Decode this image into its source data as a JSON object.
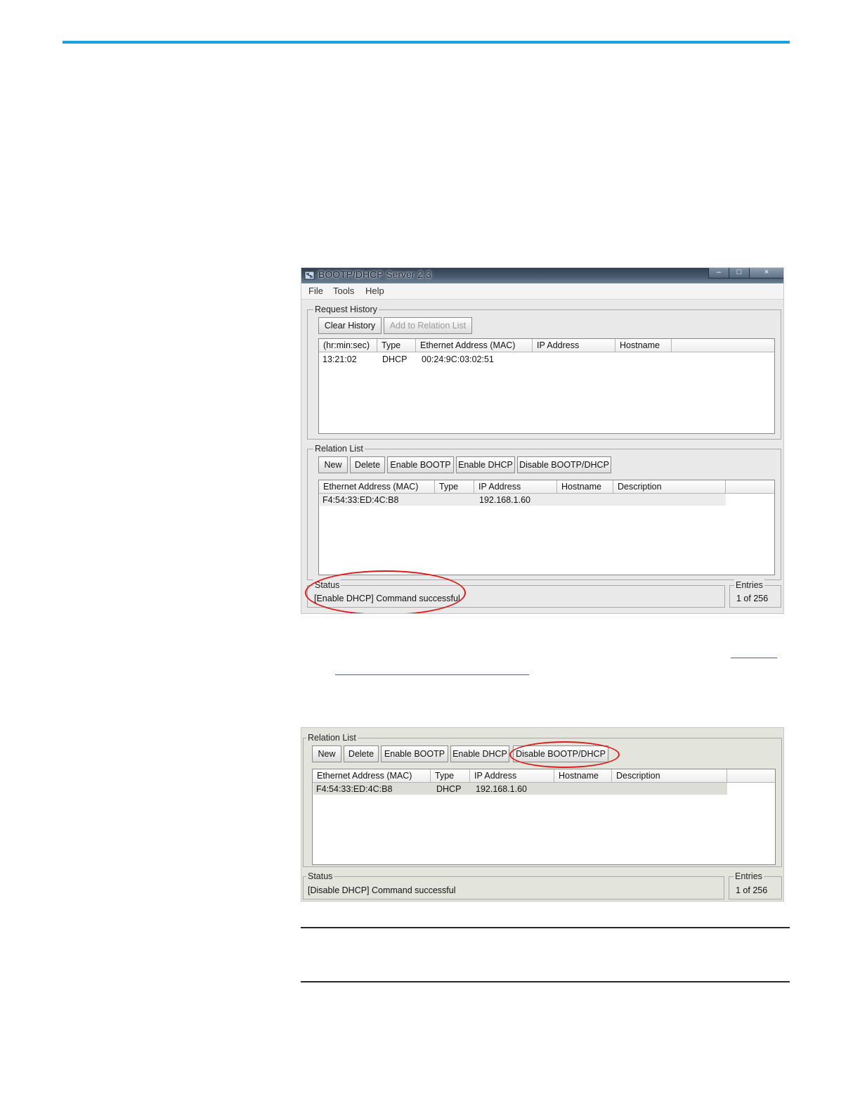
{
  "window1": {
    "title": "BOOTP/DHCP Server 2.3",
    "caption_buttons": [
      "–",
      "□",
      "×"
    ],
    "menu": [
      "File",
      "Tools",
      "Help"
    ],
    "request_history": {
      "label": "Request History",
      "buttons": [
        "Clear History",
        "Add to Relation List"
      ],
      "columns": [
        "(hr:min:sec)",
        "Type",
        "Ethernet Address (MAC)",
        "IP Address",
        "Hostname"
      ],
      "rows": [
        {
          "time": "13:21:02",
          "type": "DHCP",
          "mac": "00:24:9C:03:02:51",
          "ip": "",
          "hostname": ""
        }
      ]
    },
    "relation_list": {
      "label": "Relation List",
      "buttons": [
        "New",
        "Delete",
        "Enable BOOTP",
        "Enable DHCP",
        "Disable BOOTP/DHCP"
      ],
      "columns": [
        "Ethernet Address (MAC)",
        "Type",
        "IP Address",
        "Hostname",
        "Description"
      ],
      "rows": [
        {
          "mac": "F4:54:33:ED:4C:B8",
          "type": "",
          "ip": "192.168.1.60",
          "hostname": "",
          "description": ""
        }
      ]
    },
    "status": {
      "label": "Status",
      "text": "[Enable DHCP] Command successful"
    },
    "entries": {
      "label": "Entries",
      "text": "1 of 256"
    }
  },
  "window2": {
    "relation_list": {
      "label": "Relation List",
      "buttons": [
        "New",
        "Delete",
        "Enable BOOTP",
        "Enable DHCP",
        "Disable BOOTP/DHCP"
      ],
      "columns": [
        "Ethernet Address (MAC)",
        "Type",
        "IP Address",
        "Hostname",
        "Description"
      ],
      "rows": [
        {
          "mac": "F4:54:33:ED:4C:B8",
          "type": "DHCP",
          "ip": "192.168.1.60",
          "hostname": "",
          "description": ""
        }
      ]
    },
    "status": {
      "label": "Status",
      "text": "[Disable DHCP] Command successful"
    },
    "entries": {
      "label": "Entries",
      "text": "1 of 256"
    }
  },
  "colors": {
    "accent_rule": "#1aa3df",
    "highlight_ellipse": "#d91c1c",
    "link": "#1a6fb5"
  }
}
